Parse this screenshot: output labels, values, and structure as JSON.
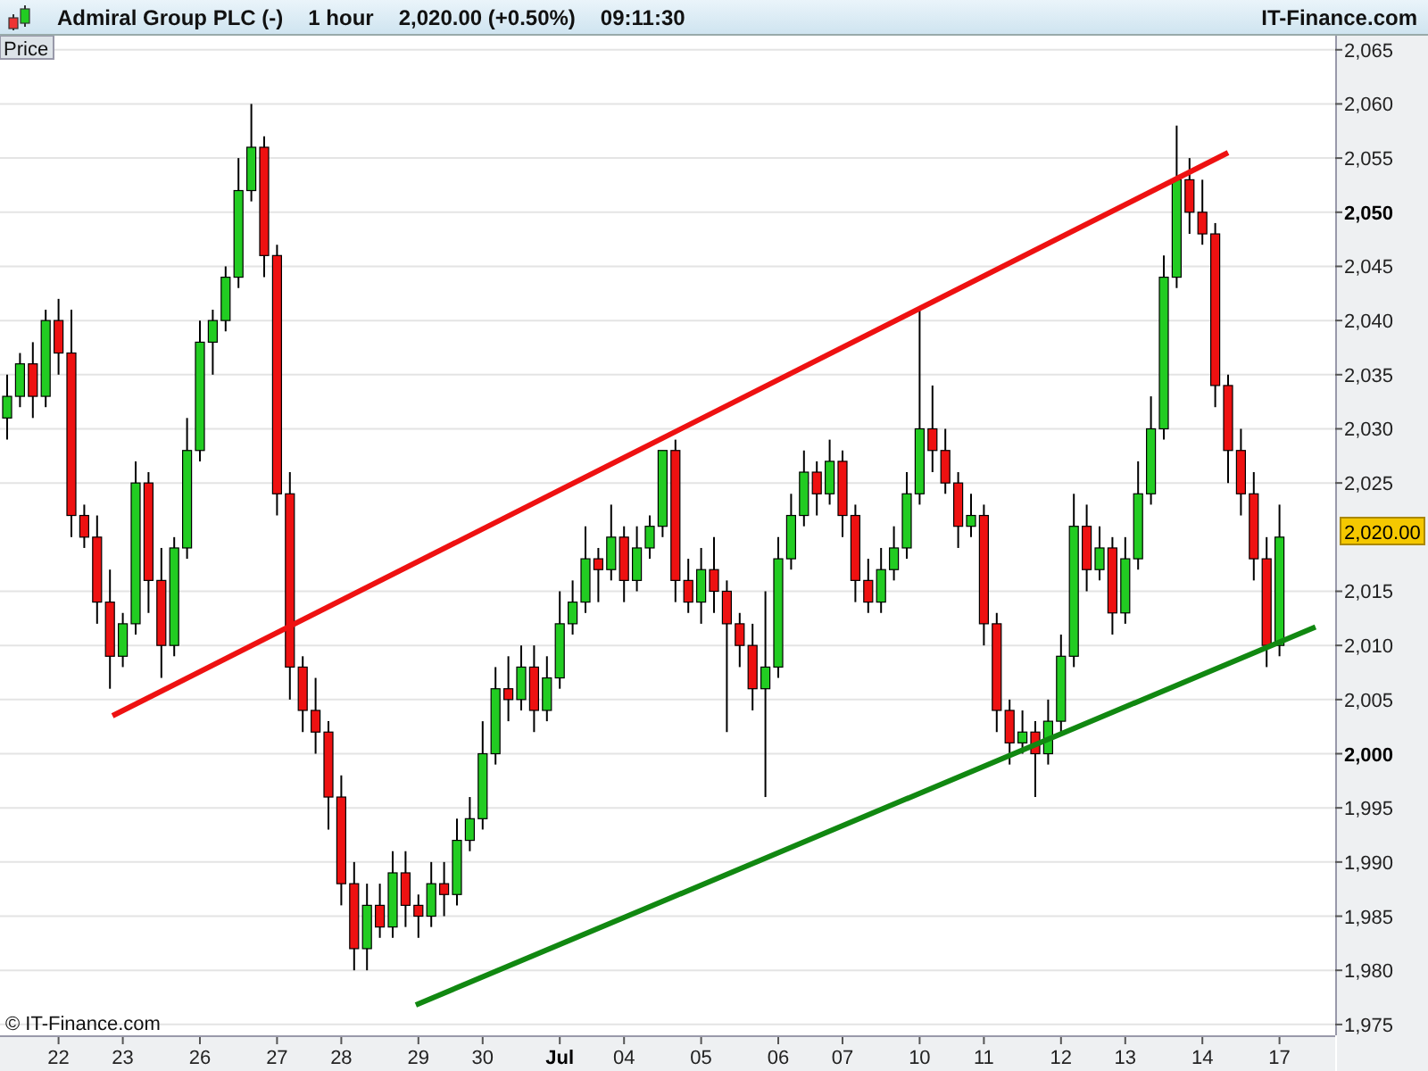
{
  "header": {
    "title": "Admiral Group PLC (-)",
    "interval": "1 hour",
    "price": "2,020.00 (+0.50%)",
    "time": "09:11:30",
    "brand": "IT-Finance.com"
  },
  "chart": {
    "legend": "Price",
    "current_price": "2,020.00",
    "copyright": "© IT-Finance.com",
    "ytick_bold": [
      false,
      false,
      false,
      true,
      false,
      false,
      false,
      false,
      false,
      false,
      false,
      false,
      true,
      false,
      false,
      false,
      false,
      false
    ],
    "date_label_bold": [
      false,
      false,
      false,
      false,
      false,
      false,
      false,
      true,
      false,
      false,
      false,
      false,
      false,
      false,
      false,
      false,
      false,
      false
    ],
    "chart_data": {
      "type": "candlestick",
      "categories": [
        null,
        null,
        null,
        null,
        "22",
        null,
        null,
        null,
        null,
        "23",
        null,
        null,
        null,
        null,
        null,
        "26",
        null,
        null,
        null,
        null,
        null,
        "27",
        null,
        null,
        null,
        null,
        "28",
        null,
        null,
        null,
        null,
        null,
        "29",
        null,
        null,
        null,
        null,
        "30",
        null,
        null,
        null,
        null,
        null,
        "Jul",
        null,
        null,
        null,
        null,
        "04",
        null,
        null,
        null,
        null,
        null,
        "05",
        null,
        null,
        null,
        null,
        null,
        "06",
        null,
        null,
        null,
        null,
        "07",
        null,
        null,
        null,
        null,
        null,
        "10",
        null,
        null,
        null,
        null,
        "11",
        null,
        null,
        null,
        null,
        null,
        "12",
        null,
        null,
        null,
        null,
        "13",
        null,
        null,
        null,
        null,
        null,
        "14",
        null,
        null,
        null,
        null,
        null,
        "17"
      ],
      "ylim": [
        1974,
        2066.3
      ],
      "grid": true,
      "ohlc": [
        [
          2031,
          2035,
          2029,
          2033
        ],
        [
          2033,
          2037,
          2032,
          2036
        ],
        [
          2036,
          2038,
          2031,
          2033
        ],
        [
          2033,
          2041,
          2032,
          2040
        ],
        [
          2040,
          2042,
          2035,
          2037
        ],
        [
          2037,
          2041,
          2020,
          2022
        ],
        [
          2022,
          2023,
          2019,
          2020
        ],
        [
          2020,
          2022,
          2012,
          2014
        ],
        [
          2014,
          2017,
          2006,
          2009
        ],
        [
          2009,
          2013,
          2008,
          2012
        ],
        [
          2012,
          2027,
          2011,
          2025
        ],
        [
          2025,
          2026,
          2013,
          2016
        ],
        [
          2016,
          2019,
          2007,
          2010
        ],
        [
          2010,
          2020,
          2009,
          2019
        ],
        [
          2019,
          2031,
          2018,
          2028
        ],
        [
          2028,
          2040,
          2027,
          2038
        ],
        [
          2038,
          2041,
          2035,
          2040
        ],
        [
          2040,
          2045,
          2039,
          2044
        ],
        [
          2044,
          2055,
          2043,
          2052
        ],
        [
          2052,
          2060,
          2051,
          2056
        ],
        [
          2056,
          2057,
          2044,
          2046
        ],
        [
          2046,
          2047,
          2022,
          2024
        ],
        [
          2024,
          2026,
          2005,
          2008
        ],
        [
          2008,
          2009,
          2002,
          2004
        ],
        [
          2004,
          2007,
          2000,
          2002
        ],
        [
          2002,
          2003,
          1993,
          1996
        ],
        [
          1996,
          1998,
          1986,
          1988
        ],
        [
          1988,
          1990,
          1980,
          1982
        ],
        [
          1982,
          1988,
          1980,
          1986
        ],
        [
          1986,
          1988,
          1983,
          1984
        ],
        [
          1984,
          1991,
          1983,
          1989
        ],
        [
          1989,
          1991,
          1984,
          1986
        ],
        [
          1986,
          1987,
          1983,
          1985
        ],
        [
          1985,
          1990,
          1984,
          1988
        ],
        [
          1988,
          1990,
          1985,
          1987
        ],
        [
          1987,
          1994,
          1986,
          1992
        ],
        [
          1992,
          1996,
          1991,
          1994
        ],
        [
          1994,
          2003,
          1993,
          2000
        ],
        [
          2000,
          2008,
          1999,
          2006
        ],
        [
          2006,
          2009,
          2003,
          2005
        ],
        [
          2005,
          2010,
          2004,
          2008
        ],
        [
          2008,
          2010,
          2002,
          2004
        ],
        [
          2004,
          2009,
          2003,
          2007
        ],
        [
          2007,
          2015,
          2006,
          2012
        ],
        [
          2012,
          2016,
          2011,
          2014
        ],
        [
          2014,
          2021,
          2013,
          2018
        ],
        [
          2018,
          2019,
          2014,
          2017
        ],
        [
          2017,
          2023,
          2016,
          2020
        ],
        [
          2020,
          2021,
          2014,
          2016
        ],
        [
          2016,
          2021,
          2015,
          2019
        ],
        [
          2019,
          2022,
          2018,
          2021
        ],
        [
          2021,
          2028,
          2020,
          2028
        ],
        [
          2028,
          2029,
          2014,
          2016
        ],
        [
          2016,
          2018,
          2013,
          2014
        ],
        [
          2014,
          2019,
          2012,
          2017
        ],
        [
          2017,
          2020,
          2013,
          2015
        ],
        [
          2015,
          2016,
          2002,
          2012
        ],
        [
          2012,
          2013,
          2008,
          2010
        ],
        [
          2010,
          2012,
          2004,
          2006
        ],
        [
          2006,
          2015,
          1996,
          2008
        ],
        [
          2008,
          2020,
          2007,
          2018
        ],
        [
          2018,
          2024,
          2017,
          2022
        ],
        [
          2022,
          2028,
          2021,
          2026
        ],
        [
          2026,
          2027,
          2022,
          2024
        ],
        [
          2024,
          2029,
          2023,
          2027
        ],
        [
          2027,
          2028,
          2020,
          2022
        ],
        [
          2022,
          2023,
          2014,
          2016
        ],
        [
          2016,
          2018,
          2013,
          2014
        ],
        [
          2014,
          2019,
          2013,
          2017
        ],
        [
          2017,
          2021,
          2016,
          2019
        ],
        [
          2019,
          2026,
          2018,
          2024
        ],
        [
          2024,
          2041,
          2023,
          2030
        ],
        [
          2030,
          2034,
          2026,
          2028
        ],
        [
          2028,
          2030,
          2024,
          2025
        ],
        [
          2025,
          2026,
          2019,
          2021
        ],
        [
          2021,
          2024,
          2020,
          2022
        ],
        [
          2022,
          2023,
          2010,
          2012
        ],
        [
          2012,
          2013,
          2002,
          2004
        ],
        [
          2004,
          2005,
          1999,
          2001
        ],
        [
          2001,
          2004,
          2000,
          2002
        ],
        [
          2002,
          2003,
          1996,
          2000
        ],
        [
          2000,
          2005,
          1999,
          2003
        ],
        [
          2003,
          2011,
          2002,
          2009
        ],
        [
          2009,
          2024,
          2008,
          2021
        ],
        [
          2021,
          2023,
          2015,
          2017
        ],
        [
          2017,
          2021,
          2016,
          2019
        ],
        [
          2019,
          2020,
          2011,
          2013
        ],
        [
          2013,
          2020,
          2012,
          2018
        ],
        [
          2018,
          2027,
          2017,
          2024
        ],
        [
          2024,
          2033,
          2023,
          2030
        ],
        [
          2030,
          2046,
          2029,
          2044
        ],
        [
          2044,
          2058,
          2043,
          2053
        ],
        [
          2053,
          2055,
          2048,
          2050
        ],
        [
          2050,
          2053,
          2047,
          2048
        ],
        [
          2048,
          2049,
          2032,
          2034
        ],
        [
          2034,
          2035,
          2025,
          2028
        ],
        [
          2028,
          2030,
          2022,
          2024
        ],
        [
          2024,
          2026,
          2016,
          2018
        ],
        [
          2018,
          2020,
          2008,
          2010
        ],
        [
          2010,
          2023,
          2009,
          2020
        ]
      ],
      "yticks": [
        {
          "value": 2065,
          "label": "2,065"
        },
        {
          "value": 2060,
          "label": "2,060"
        },
        {
          "value": 2055,
          "label": "2,055"
        },
        {
          "value": 2050,
          "label": "2,050"
        },
        {
          "value": 2045,
          "label": "2,045"
        },
        {
          "value": 2040,
          "label": "2,040"
        },
        {
          "value": 2035,
          "label": "2,035"
        },
        {
          "value": 2030,
          "label": "2,030"
        },
        {
          "value": 2025,
          "label": "2,025"
        },
        {
          "value": 2015,
          "label": "2,015"
        },
        {
          "value": 2010,
          "label": "2,010"
        },
        {
          "value": 2005,
          "label": "2,005"
        },
        {
          "value": 2000,
          "label": "2,000"
        },
        {
          "value": 1995,
          "label": "1,995"
        },
        {
          "value": 1990,
          "label": "1,990"
        },
        {
          "value": 1985,
          "label": "1,985"
        },
        {
          "value": 1980,
          "label": "1,980"
        },
        {
          "value": 1975,
          "label": "1,975"
        }
      ]
    }
  }
}
